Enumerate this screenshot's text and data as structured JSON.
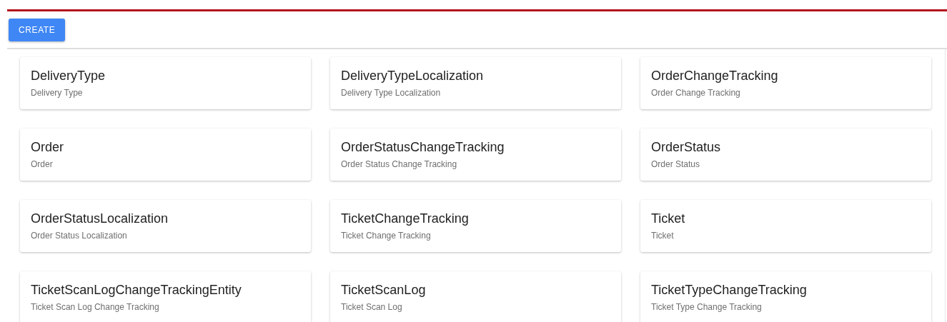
{
  "create_button": {
    "label": "CREATE"
  },
  "cards": [
    {
      "title": "DeliveryType",
      "subtitle": "Delivery Type"
    },
    {
      "title": "DeliveryTypeLocalization",
      "subtitle": "Delivery Type Localization"
    },
    {
      "title": "OrderChangeTracking",
      "subtitle": "Order Change Tracking"
    },
    {
      "title": "Order",
      "subtitle": "Order"
    },
    {
      "title": "OrderStatusChangeTracking",
      "subtitle": "Order Status Change Tracking"
    },
    {
      "title": "OrderStatus",
      "subtitle": "Order Status"
    },
    {
      "title": "OrderStatusLocalization",
      "subtitle": "Order Status Localization"
    },
    {
      "title": "TicketChangeTracking",
      "subtitle": "Ticket Change Tracking"
    },
    {
      "title": "Ticket",
      "subtitle": "Ticket"
    },
    {
      "title": "TicketScanLogChangeTrackingEntity",
      "subtitle": "Ticket Scan Log Change Tracking"
    },
    {
      "title": "TicketScanLog",
      "subtitle": "Ticket Scan Log"
    },
    {
      "title": "TicketTypeChangeTracking",
      "subtitle": "Ticket Type Change Tracking"
    }
  ]
}
